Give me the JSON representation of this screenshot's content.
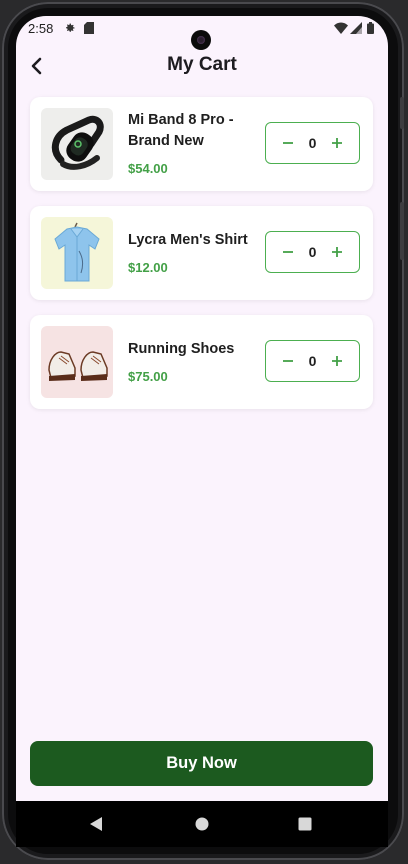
{
  "status_bar": {
    "time": "2:58"
  },
  "app_bar": {
    "title": "My Cart"
  },
  "cart": {
    "items": [
      {
        "name": "Mi Band 8 Pro - Brand New",
        "price": "$54.00",
        "quantity": "0",
        "image": "fitness-band-image"
      },
      {
        "name": "Lycra Men's Shirt",
        "price": "$12.00",
        "quantity": "0",
        "image": "blue-shirt-image"
      },
      {
        "name": "Running Shoes",
        "price": "$75.00",
        "quantity": "0",
        "image": "sneakers-image"
      }
    ]
  },
  "footer": {
    "buy_label": "Buy Now"
  },
  "colors": {
    "accent_green": "#43a047",
    "button_dark_green": "#1c5a1f",
    "background": "#fbf3fd"
  }
}
